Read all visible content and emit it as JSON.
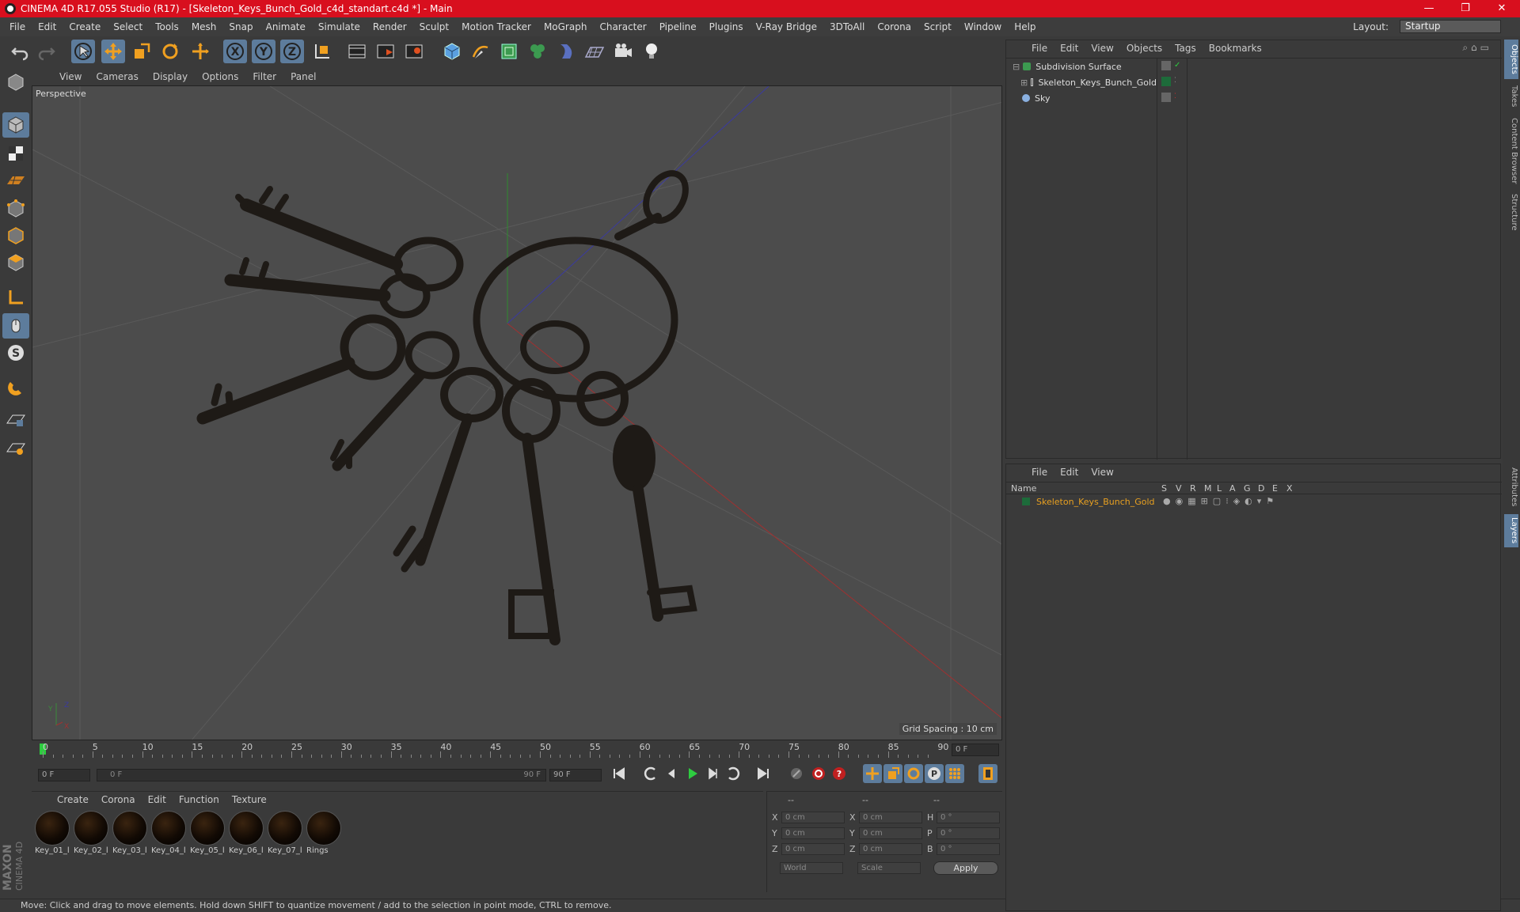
{
  "window": {
    "title": "CINEMA 4D R17.055 Studio (R17) - [Skeleton_Keys_Bunch_Gold_c4d_standart.c4d *] - Main"
  },
  "menu": [
    "File",
    "Edit",
    "Create",
    "Select",
    "Tools",
    "Mesh",
    "Snap",
    "Animate",
    "Simulate",
    "Render",
    "Sculpt",
    "Motion Tracker",
    "MoGraph",
    "Character",
    "Pipeline",
    "Plugins",
    "V-Ray Bridge",
    "3DToAll",
    "Corona",
    "Script",
    "Window",
    "Help"
  ],
  "layout": {
    "label": "Layout:",
    "value": "Startup"
  },
  "viewport": {
    "menu": [
      "View",
      "Cameras",
      "Display",
      "Options",
      "Filter",
      "Panel"
    ],
    "label": "Perspective",
    "grid_spacing": "Grid Spacing : 10 cm"
  },
  "timeline": {
    "ticks": [
      "0",
      "5",
      "10",
      "15",
      "20",
      "25",
      "30",
      "35",
      "40",
      "45",
      "50",
      "55",
      "60",
      "65",
      "70",
      "75",
      "80",
      "85",
      "90"
    ],
    "current_frame": "0 F",
    "start_field": "0 F",
    "range_start": "0 F",
    "range_end": "90 F",
    "end_field": "90 F"
  },
  "materials": {
    "menu": [
      "Create",
      "Corona",
      "Edit",
      "Function",
      "Texture"
    ],
    "items": [
      "Key_01_l",
      "Key_02_l",
      "Key_03_l",
      "Key_04_l",
      "Key_05_l",
      "Key_06_l",
      "Key_07_l",
      "Rings"
    ]
  },
  "coords": {
    "headers": [
      "--",
      "--",
      "--"
    ],
    "rows": [
      {
        "a": "X",
        "av": "0 cm",
        "b": "X",
        "bv": "0 cm",
        "c": "H",
        "cv": "0 °"
      },
      {
        "a": "Y",
        "av": "0 cm",
        "b": "Y",
        "bv": "0 cm",
        "c": "P",
        "cv": "0 °"
      },
      {
        "a": "Z",
        "av": "0 cm",
        "b": "Z",
        "bv": "0 cm",
        "c": "B",
        "cv": "0 °"
      }
    ],
    "mode1": "World",
    "mode2": "Scale",
    "apply": "Apply"
  },
  "objects": {
    "menu": [
      "File",
      "Edit",
      "View",
      "Objects",
      "Tags",
      "Bookmarks"
    ],
    "items": [
      "Subdivision Surface",
      "Skeleton_Keys_Bunch_Gold",
      "Sky"
    ]
  },
  "layers": {
    "menu": [
      "File",
      "Edit",
      "View"
    ],
    "name_header": "Name",
    "flags": [
      "S",
      "V",
      "R",
      "M",
      "L",
      "A",
      "G",
      "D",
      "E",
      "X"
    ],
    "items": [
      "Skeleton_Keys_Bunch_Gold"
    ]
  },
  "right_tabs": [
    "Objects",
    "Takes",
    "Content Browser",
    "Structure",
    "Attributes",
    "Layers"
  ],
  "status": "Move: Click and drag to move elements. Hold down SHIFT to quantize movement / add to the selection in point mode, CTRL to remove.",
  "brand": "MAXON CINEMA 4D",
  "colors": {
    "accent": "#5d7c9c",
    "title_bar": "#d80f1e",
    "layer_item": "#e8a020",
    "layer_swatch": "#1d6b3a"
  }
}
